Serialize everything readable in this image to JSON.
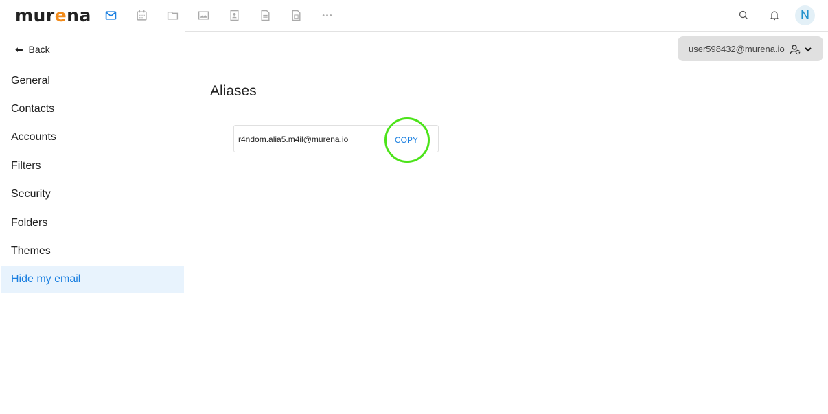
{
  "logo": {
    "pre": "mur",
    "e": "e",
    "post": "na"
  },
  "apps": [
    "mail-icon",
    "calendar-icon",
    "folder-icon",
    "photos-icon",
    "contacts-icon",
    "notes-icon",
    "spreadsheet-icon",
    "more-icon"
  ],
  "header": {
    "avatar_initial": "N",
    "accent": "#1a7fe0"
  },
  "back_label": "Back",
  "sidebar": {
    "items": [
      {
        "label": "General"
      },
      {
        "label": "Contacts"
      },
      {
        "label": "Accounts"
      },
      {
        "label": "Filters"
      },
      {
        "label": "Security"
      },
      {
        "label": "Folders"
      },
      {
        "label": "Themes"
      },
      {
        "label": "Hide my email",
        "active": true
      }
    ]
  },
  "account": {
    "email": "user598432@murena.io"
  },
  "main": {
    "title": "Aliases",
    "alias": "r4ndom.alia5.m4il@murena.io",
    "copy_label": "COPY"
  }
}
